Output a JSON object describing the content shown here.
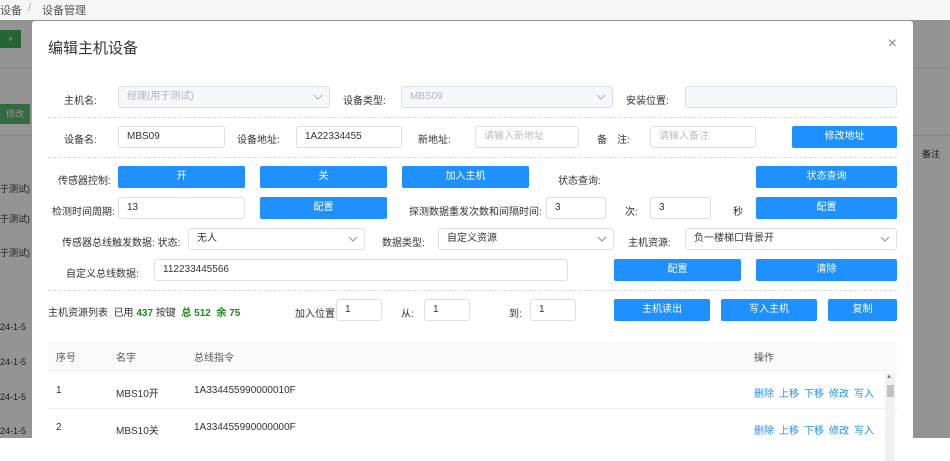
{
  "background": {
    "breadcrumb": [
      "设备",
      "/",
      "设备管理"
    ],
    "green_button": "+",
    "edit_button": "修改",
    "left_cells": [
      "于测试)",
      "于测试)",
      "于测试)",
      "24-1-5",
      "24-1-5",
      "24-1-5",
      "24-1-5"
    ],
    "right_header": "备注"
  },
  "modal": {
    "title": "编辑主机设备",
    "close": "×",
    "row1": {
      "host_label": "主机名:",
      "host_value": "经理(用于测试)",
      "type_label": "设备类型:",
      "type_value": "MBS09",
      "location_label": "安装位置:",
      "location_value": ""
    },
    "row2": {
      "name_label": "设备名:",
      "name_value": "MBS09",
      "addr_label": "设备地址:",
      "addr_value": "1A22334455",
      "newaddr_label": "新地址:",
      "newaddr_placeholder": "请输入新地址",
      "note_label": "备　注:",
      "note_placeholder": "请输入备注",
      "modify_btn": "修改地址"
    },
    "sensor": {
      "ctrl_label": "传感器控制:",
      "on_btn": "开",
      "off_btn": "关",
      "join_btn": "加入主机",
      "status_label": "状态查询:",
      "status_btn": "状态查询",
      "period_label": "检测时间周期:",
      "period_value": "13",
      "config_btn": "配置",
      "repeat_label": "探测数据重发次数和间隔时间:",
      "repeat_value": "3",
      "times_label": "次:",
      "interval_value": "3",
      "sec_label": "秒",
      "config_btn2": "配置"
    },
    "bus": {
      "trigger_label": "传感器总线触发数据: 状态:",
      "state_value": "无人",
      "dtype_label": "数据类型:",
      "dtype_value": "自定义资源",
      "res_label": "主机资源:",
      "res_value": "负一楼梯口背景开",
      "custom_label": "自定义总线数据:",
      "custom_value": "112233445566",
      "config_btn": "配置",
      "clear_btn": "清除"
    },
    "resource": {
      "list_label": "主机资源列表",
      "used_label": "已用",
      "used_value": "437",
      "key_label": "按键",
      "total_label": "总",
      "total_value": "512",
      "rem_label": "余",
      "rem_value": "75",
      "join_pos_label": "加入位置",
      "join_pos_value": "1",
      "from_label": "从:",
      "from_value": "1",
      "to_label": "到:",
      "to_value": "1",
      "read_btn": "主机读出",
      "write_btn": "写入主机",
      "copy_btn": "复制"
    },
    "table": {
      "headers": [
        "序号",
        "名字",
        "总线指令",
        "操作"
      ],
      "rows": [
        {
          "no": "1",
          "name": "MBS10开",
          "cmd": "1A334455990000010F"
        },
        {
          "no": "2",
          "name": "MBS10关",
          "cmd": "1A334455990000000F"
        }
      ],
      "ops": [
        "删除",
        "上移",
        "下移",
        "修改",
        "写入"
      ]
    }
  },
  "colors": {
    "primary": "#1e90ff",
    "green_count": "#1a8a1a",
    "overlay": "rgba(0,0,0,0.42)"
  }
}
